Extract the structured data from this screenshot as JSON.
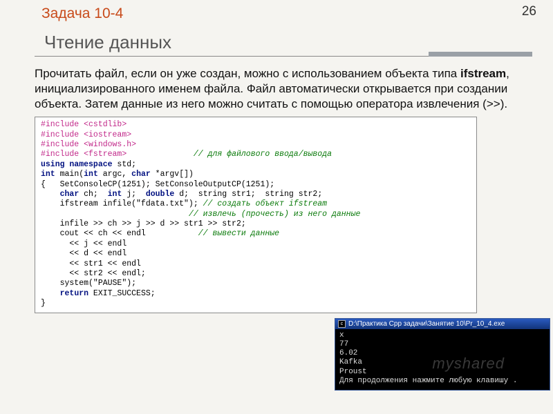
{
  "page_number": "26",
  "task_label": "Задача 10-4",
  "title": "Чтение данных",
  "paragraph_parts": {
    "p1": "Прочитать файл, если он уже создан, можно с использованием объекта типа ",
    "bold": "ifstream",
    "p2": ", инициализированного именем файла. Файл автоматически открывается при создании объекта. Затем данные из него можно считать с помощью оператора извлечения (>>)."
  },
  "code": {
    "l1_a": "#include ",
    "l1_b": "<cstdlib>",
    "l2_a": "#include ",
    "l2_b": "<iostream>",
    "l3_a": "#include ",
    "l3_b": "<windows.h>",
    "l4_a": "#include ",
    "l4_b": "<fstream>",
    "l4_pad": "              ",
    "l4_c": "// для файлового ввода/вывода",
    "l5_a": "using namespace",
    "l5_b": " std;",
    "l6_a": "int",
    "l6_b": " main(",
    "l6_c": "int",
    "l6_d": " argc, ",
    "l6_e": "char",
    "l6_f": " *argv[])",
    "l7": "{   SetConsoleCP(1251); SetConsoleOutputCP(1251);",
    "l8_a": "    ",
    "l8_b": "char",
    "l8_c": " ch;  ",
    "l8_d": "int",
    "l8_e": " j;  ",
    "l8_f": "double",
    "l8_g": " d;  string str1;  string str2;",
    "l9_a": "    ifstream infile(\"fdata.txt\"); ",
    "l9_b": "// создать объект ifstream",
    "l10_a": "                               ",
    "l10_b": "// извлечь (прочесть) из него данные",
    "l11": "    infile >> ch >> j >> d >> str1 >> str2;",
    "l12_a": "    cout << ch << endl           ",
    "l12_b": "// вывести данные",
    "l13": "      << j << endl",
    "l14": "      << d << endl",
    "l15": "      << str1 << endl",
    "l16": "      << str2 << endl;",
    "l17": "    system(\"PAUSE\");",
    "l18_a": "    ",
    "l18_b": "return",
    "l18_c": " EXIT_SUCCESS;",
    "l19": "}"
  },
  "console": {
    "title": "D:\\Практика Cpp задачи\\Занятие 10\\Pr_10_4.exe",
    "out1": "x",
    "out2": "77",
    "out3": "6.02",
    "out4": "Kafka",
    "out5": "Proust",
    "out6": "Для продолжения нажмите любую клавишу ."
  },
  "watermark": "myshared"
}
